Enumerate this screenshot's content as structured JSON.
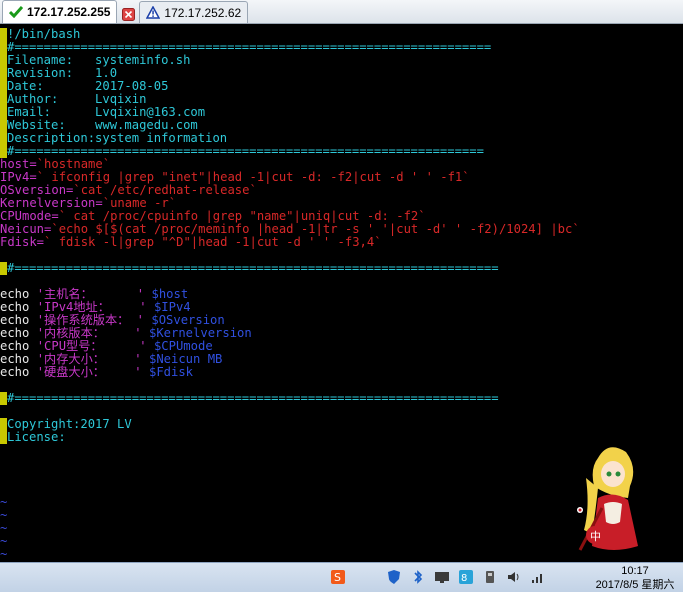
{
  "tabs": [
    {
      "label": "172.17.252.255",
      "status": "connected"
    },
    {
      "label": "172.17.252.62",
      "status": "warning"
    }
  ],
  "terminal": {
    "lines": [
      {
        "text": "!/bin/bash",
        "cls": "c",
        "cursor": true
      },
      {
        "text": "#=================================================================",
        "cls": "c",
        "cursor": true
      },
      {
        "text": "Filename:   systeminfo.sh",
        "cls": "c",
        "cursor": true
      },
      {
        "text": "Revision:   1.0",
        "cls": "c",
        "cursor": true
      },
      {
        "text": "Date:       2017-08-05",
        "cls": "c",
        "cursor": true
      },
      {
        "text": "Author:     Lvqixin",
        "cls": "c",
        "cursor": true
      },
      {
        "text": "Email:      Lvqixin@163.com",
        "cls": "c",
        "cursor": true
      },
      {
        "text": "Website:    www.magedu.com",
        "cls": "c",
        "cursor": true
      },
      {
        "text": "Description:system information",
        "cls": "c",
        "cursor": true
      },
      {
        "text": "#================================================================",
        "cls": "c",
        "cursor": true
      }
    ],
    "vars": [
      {
        "name": "host=",
        "rest": "`hostname`"
      },
      {
        "name": "IPv4=",
        "rest": "` ifconfig |grep \"inet\"|head -1|cut -d: -f2|cut -d ' ' -f1`"
      },
      {
        "name": "OSversion=",
        "rest": "`cat /etc/redhat-release`"
      },
      {
        "name": "Kernelversion=",
        "rest": "`uname -r`"
      },
      {
        "name": "CPUmode=",
        "rest": "` cat /proc/cpuinfo |grep \"name\"|uniq|cut -d: -f2`"
      },
      {
        "name": "Neicun=",
        "rest": "`echo $[$(cat /proc/meminfo |head -1|tr -s ' '|cut -d' ' -f2)/1024] |bc`"
      },
      {
        "name": "Fdisk=",
        "rest": "` fdisk -l|grep \"^D\"|head -1|cut -d ' ' -f3,4`"
      }
    ],
    "sep1": "#==================================================================",
    "echos": [
      {
        "kw": "echo",
        "label": "'主机名：      '",
        "var": "$host"
      },
      {
        "kw": "echo",
        "label": "'IPv4地址：    '",
        "var": "$IPv4"
      },
      {
        "kw": "echo",
        "label": "'操作系统版本： '",
        "var": "$OSversion"
      },
      {
        "kw": "echo",
        "label": "'内核版本：    '",
        "var": "$Kernelversion"
      },
      {
        "kw": "echo",
        "label": "'CPU型号：     '",
        "var": "$CPUmode"
      },
      {
        "kw": "echo",
        "label": "'内存大小：    '",
        "var": "$Neicun MB"
      },
      {
        "kw": "echo",
        "label": "'硬盘大小：    '",
        "var": "$Fdisk"
      }
    ],
    "sep2": "#==================================================================",
    "footer": [
      "Copyright:2017 LV",
      "License:"
    ],
    "tildes": [
      "~",
      "~",
      "~",
      "~",
      "~"
    ]
  },
  "taskbar": {
    "time": "10:17",
    "date": "2017/8/5 星期六",
    "ime_label": "中"
  },
  "colors": {
    "comment": "#2ec8d8",
    "var": "#c838c8",
    "string": "#d82828",
    "cursor": "#c8c800",
    "tilde": "#3a4ad8"
  }
}
